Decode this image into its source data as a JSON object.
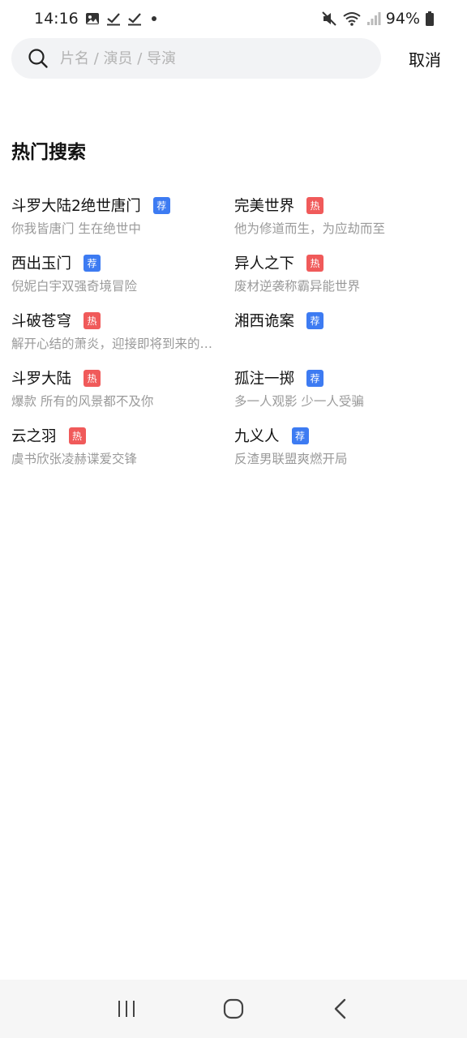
{
  "status_bar": {
    "time": "14:16",
    "battery": "94%"
  },
  "search": {
    "placeholder": "片名 / 演员 / 导演",
    "value": "",
    "cancel_label": "取消"
  },
  "hot_search": {
    "title": "热门搜索",
    "items": [
      {
        "title": "斗罗大陆2绝世唐门",
        "badge": "荐",
        "badge_type": "tui",
        "subtitle": "你我皆唐门 生在绝世中"
      },
      {
        "title": "完美世界",
        "badge": "热",
        "badge_type": "hot",
        "subtitle": "他为修道而生，为应劫而至"
      },
      {
        "title": "西出玉门",
        "badge": "荐",
        "badge_type": "tui",
        "subtitle": "倪妮白宇双强奇境冒险"
      },
      {
        "title": "异人之下",
        "badge": "热",
        "badge_type": "hot",
        "subtitle": "废材逆袭称霸异能世界"
      },
      {
        "title": "斗破苍穹",
        "badge": "热",
        "badge_type": "hot",
        "subtitle": "解开心结的萧炎，迎接即将到来的…"
      },
      {
        "title": "湘西诡案",
        "badge": "荐",
        "badge_type": "tui",
        "subtitle": ""
      },
      {
        "title": "斗罗大陆",
        "badge": "热",
        "badge_type": "hot",
        "subtitle": "爆款 所有的风景都不及你"
      },
      {
        "title": "孤注一掷",
        "badge": "荐",
        "badge_type": "tui",
        "subtitle": "多一人观影 少一人受骗"
      },
      {
        "title": "云之羽",
        "badge": "热",
        "badge_type": "hot",
        "subtitle": "虞书欣张凌赫谍爱交锋"
      },
      {
        "title": "九义人",
        "badge": "荐",
        "badge_type": "tui",
        "subtitle": "反渣男联盟爽燃开局"
      }
    ]
  },
  "colors": {
    "badge_tui": "#3d7bf2",
    "badge_hot": "#f05a5a",
    "search_bg": "#f2f3f5",
    "subtitle": "#9a9a9a"
  },
  "icons": {
    "search": "search-icon",
    "nav_recents": "recents-icon",
    "nav_home": "home-icon",
    "nav_back": "back-icon"
  }
}
